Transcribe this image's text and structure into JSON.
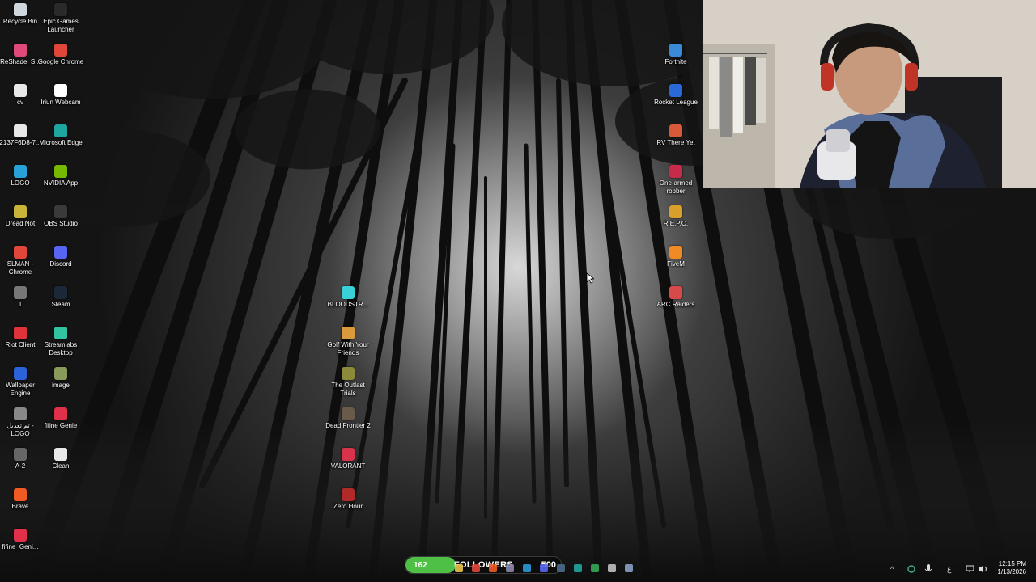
{
  "desktop": {
    "left_column_1": [
      {
        "label": "Recycle Bin",
        "icon": "recycle-bin-icon",
        "color": "#cfd6dd"
      },
      {
        "label": "ReShade_S...",
        "icon": "reshade-icon",
        "color": "#e04a7a"
      },
      {
        "label": "cv",
        "icon": "file-icon",
        "color": "#e8e8e8"
      },
      {
        "label": "2137F6D8-7...",
        "icon": "file-icon",
        "color": "#e8e8e8"
      },
      {
        "label": "LOGO",
        "icon": "shortcut-icon",
        "color": "#2aa0d8"
      },
      {
        "label": "Dread Not",
        "icon": "dread-not-icon",
        "color": "#c9b33a"
      },
      {
        "label": "SLMAN - Chrome",
        "icon": "chrome-icon",
        "color": "#e0463a"
      },
      {
        "label": "1",
        "icon": "file-icon",
        "color": "#777"
      },
      {
        "label": "Riot Client",
        "icon": "riot-client-icon",
        "color": "#e0323a"
      },
      {
        "label": "Wallpaper Engine",
        "icon": "wallpaper-engine-icon",
        "color": "#2c62d8"
      },
      {
        "label": "تم تعديل - LOGO",
        "icon": "shortcut-icon",
        "color": "#888"
      },
      {
        "label": "A-2",
        "icon": "file-icon",
        "color": "#666"
      },
      {
        "label": "Brave",
        "icon": "brave-icon",
        "color": "#f05a24"
      },
      {
        "label": "fifine_Geni...",
        "icon": "fifine-icon",
        "color": "#e0304a"
      }
    ],
    "left_column_2": [
      {
        "label": "Epic Games Launcher",
        "icon": "epic-games-icon",
        "color": "#2a2a2a"
      },
      {
        "label": "Google Chrome",
        "icon": "chrome-icon",
        "color": "#e0463a"
      },
      {
        "label": "Iriun Webcam",
        "icon": "webcam-icon",
        "color": "#ffffff"
      },
      {
        "label": "Microsoft Edge",
        "icon": "edge-icon",
        "color": "#1ea7a0"
      },
      {
        "label": "NVIDIA App",
        "icon": "nvidia-icon",
        "color": "#76b900"
      },
      {
        "label": "OBS Studio",
        "icon": "obs-icon",
        "color": "#3a3a3a"
      },
      {
        "label": "Discord",
        "icon": "discord-icon",
        "color": "#5865f2"
      },
      {
        "label": "Steam",
        "icon": "steam-icon",
        "color": "#1b2838"
      },
      {
        "label": "Streamlabs Desktop",
        "icon": "streamlabs-icon",
        "color": "#31c3a2"
      },
      {
        "label": "image",
        "icon": "image-icon",
        "color": "#8a9a5a"
      },
      {
        "label": "fifine Genie",
        "icon": "fifine-icon",
        "color": "#e0304a"
      },
      {
        "label": "Clean",
        "icon": "file-icon",
        "color": "#e8e8e8"
      }
    ],
    "center_column": [
      {
        "label": "BLOODSTR...",
        "icon": "bloodstrike-icon",
        "color": "#3ad0d8"
      },
      {
        "label": "Golf With Your Friends",
        "icon": "golf-icon",
        "color": "#d89a3a"
      },
      {
        "label": "The Outlast Trials",
        "icon": "outlast-icon",
        "color": "#8a8a3a"
      },
      {
        "label": "Dead Frontier 2",
        "icon": "dead-frontier-icon",
        "color": "#6a5a4a"
      },
      {
        "label": "VALORANT",
        "icon": "valorant-icon",
        "color": "#d8334a"
      },
      {
        "label": "Zero Hour",
        "icon": "zero-hour-icon",
        "color": "#b02a2a"
      }
    ],
    "right_column": [
      {
        "label": "Fortnite",
        "icon": "fortnite-icon",
        "color": "#3a8ad8"
      },
      {
        "label": "Rocket League",
        "icon": "rocket-league-icon",
        "color": "#2a6ad8"
      },
      {
        "label": "RV There Yet",
        "icon": "rv-icon",
        "color": "#d85a3a"
      },
      {
        "label": "One-armed robber",
        "icon": "one-armed-robber-icon",
        "color": "#c82a4a"
      },
      {
        "label": "R.E.P.O.",
        "icon": "repo-icon",
        "color": "#d8a02a"
      },
      {
        "label": "FiveM",
        "icon": "fivem-icon",
        "color": "#f08a24"
      },
      {
        "label": "ARC Raiders",
        "icon": "arc-raiders-icon",
        "color": "#d84a4a"
      }
    ]
  },
  "follower_goal": {
    "current": "162",
    "label": "FOLLOWERS",
    "goal": "500",
    "progress": 0.324,
    "fill_color": "#4fc046"
  },
  "taskbar": {
    "apps": [
      {
        "icon": "file-explorer-icon",
        "color": "#e8c24a"
      },
      {
        "icon": "chrome-icon",
        "color": "#e0463a"
      },
      {
        "icon": "brave-icon",
        "color": "#f05a24"
      },
      {
        "icon": "obs-icon",
        "color": "#8888aa"
      },
      {
        "icon": "terminal-icon",
        "color": "#2a9ad8"
      },
      {
        "icon": "discord-icon",
        "color": "#5865f2"
      },
      {
        "icon": "steam-icon",
        "color": "#4a6a8a"
      },
      {
        "icon": "edge-icon",
        "color": "#1ea7a0"
      },
      {
        "icon": "chrome-icon",
        "color": "#34a853"
      },
      {
        "icon": "app-icon",
        "color": "#c0c0c0"
      },
      {
        "icon": "settings-icon",
        "color": "#8aa0c8"
      }
    ],
    "tray": {
      "chevron": "^",
      "lang": "ع"
    },
    "clock": {
      "time": "12:15 PM",
      "date": "1/13/2026"
    }
  }
}
